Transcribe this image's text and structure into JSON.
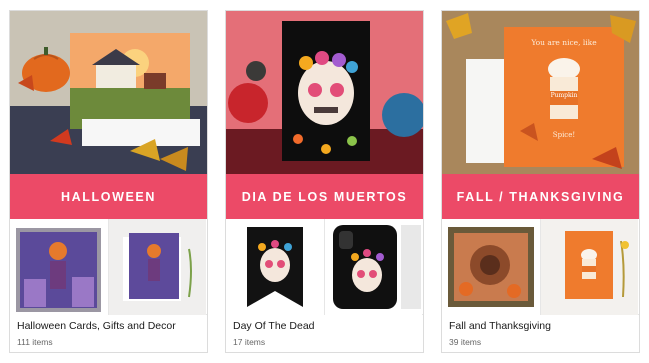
{
  "categories": [
    {
      "banner": "HALLOWEEN",
      "title": "Halloween Cards, Gifts and Decor",
      "count": "111 items"
    },
    {
      "banner": "DIA DE LOS MUERTOS",
      "title": "Day Of The Dead",
      "count": "17 items"
    },
    {
      "banner": "FALL / THANKSGIVING",
      "title": "Fall and Thanksgiving",
      "count": "39 items",
      "card_text": {
        "line1": "You are nice, like",
        "label": "Pumpkin",
        "label2": "Spice!"
      }
    }
  ],
  "colors": {
    "banner": "#ec4a67",
    "pumpkin_orange": "#ef7b2d",
    "card_dark": "#151515"
  }
}
